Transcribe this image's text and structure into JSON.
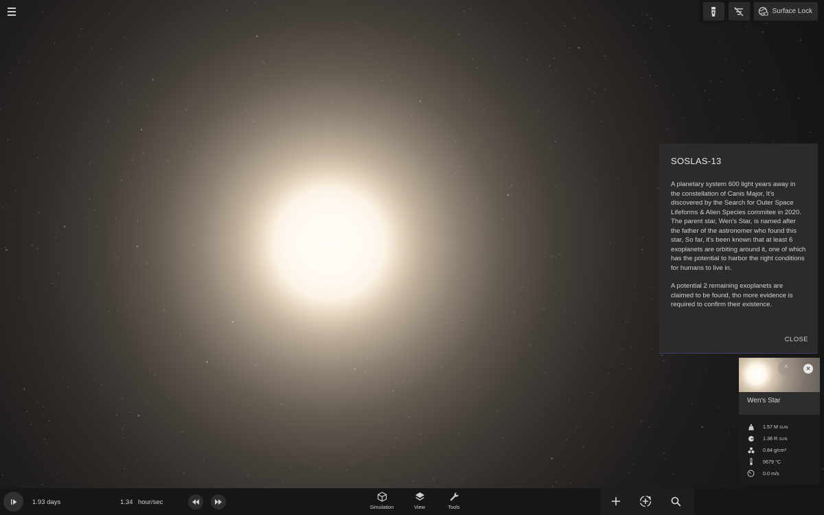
{
  "icons": {
    "menu": "hamburger-menu-icon",
    "flashlight": "flashlight-icon",
    "filter": "filter-off-icon",
    "surface_lock": "globe-lock-icon",
    "play": "play-icon",
    "rewind": "rewind-icon",
    "fast_forward": "fast-forward-icon",
    "simulation": "cube-icon",
    "view": "layers-icon",
    "tools": "wrench-icon",
    "add": "plus-icon",
    "orbit_add": "orbit-add-icon",
    "search": "search-icon"
  },
  "top_bar": {
    "surface_lock_label": "Surface Lock"
  },
  "info_panel": {
    "title": "SOSLAS-13",
    "paragraphs": [
      "A planetary system 600 light years away in the constellation of Canis Major, It's discovered by the Search for Outer Space Lifeforms & Alien Species commitee in 2020. The parent star, Wen's Star, is named after the father of the astronomer who found this star, So far, it's been known that at least 6 exoplanets are orbiting around it, one of which has the potential to harbor the right conditions for humans to live in.",
      "A potential 2 remaining exoplanets are claimed to be found, tho more evidence is required to confirm their existence."
    ],
    "close_label": "CLOSE"
  },
  "object_card": {
    "name": "Wen's Star",
    "expand_glyph": "^",
    "close_glyph": "×",
    "properties": [
      {
        "icon": "mass-weight-icon",
        "value": "1.57 M",
        "unit": "SUN"
      },
      {
        "icon": "radius-icon",
        "value": "1.38 R",
        "unit": "SUN"
      },
      {
        "icon": "density-icon",
        "value": "0.84 g/cm³",
        "unit": ""
      },
      {
        "icon": "thermometer-icon",
        "value": "5679 °C",
        "unit": ""
      },
      {
        "icon": "speedometer-icon",
        "value": "0.0 m/s",
        "unit": ""
      }
    ]
  },
  "bottom_bar": {
    "elapsed": "1.93 days",
    "rate_value": "1.34",
    "rate_unit": "hour/sec",
    "tabs": [
      {
        "label": "Simulation"
      },
      {
        "label": "View"
      },
      {
        "label": "Tools"
      }
    ]
  },
  "colors": {
    "background": "#161514",
    "panel": "#2c2c2e",
    "panel_accent_line": "#3b3f6a",
    "bar": "#161616",
    "text": "#d2d2d2"
  }
}
